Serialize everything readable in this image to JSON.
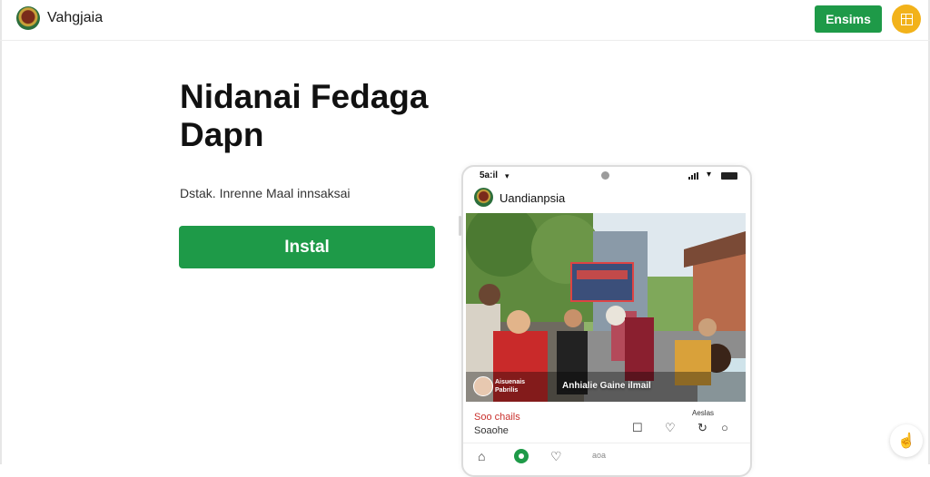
{
  "header": {
    "brand": "Vahgjaia",
    "button_label": "Ensims"
  },
  "hero": {
    "title": "Nidanai Fedaga Dapn",
    "subtitle": "Dstak. Inrenne Maal innsaksai",
    "install_label": "Instal"
  },
  "phone": {
    "status_time": "5a:il",
    "app_name": "Uandianpsia",
    "photo_caption": "Anhialie Gaine ilmail",
    "photo_user": [
      "Aisuenais",
      "Pabrilis"
    ],
    "meta_left_1": "Soo chails",
    "meta_left_2": "Soaohe",
    "meta_right": "Aeslas",
    "nav_text": "aoa",
    "icons": [
      "comment-icon",
      "heart-icon",
      "share-icon",
      "home-icon",
      "add-icon",
      "like-icon"
    ]
  },
  "colors": {
    "accent_green": "#1e9a48",
    "avatar_yellow": "#f2b21a",
    "meta_red": "#c9302c"
  }
}
